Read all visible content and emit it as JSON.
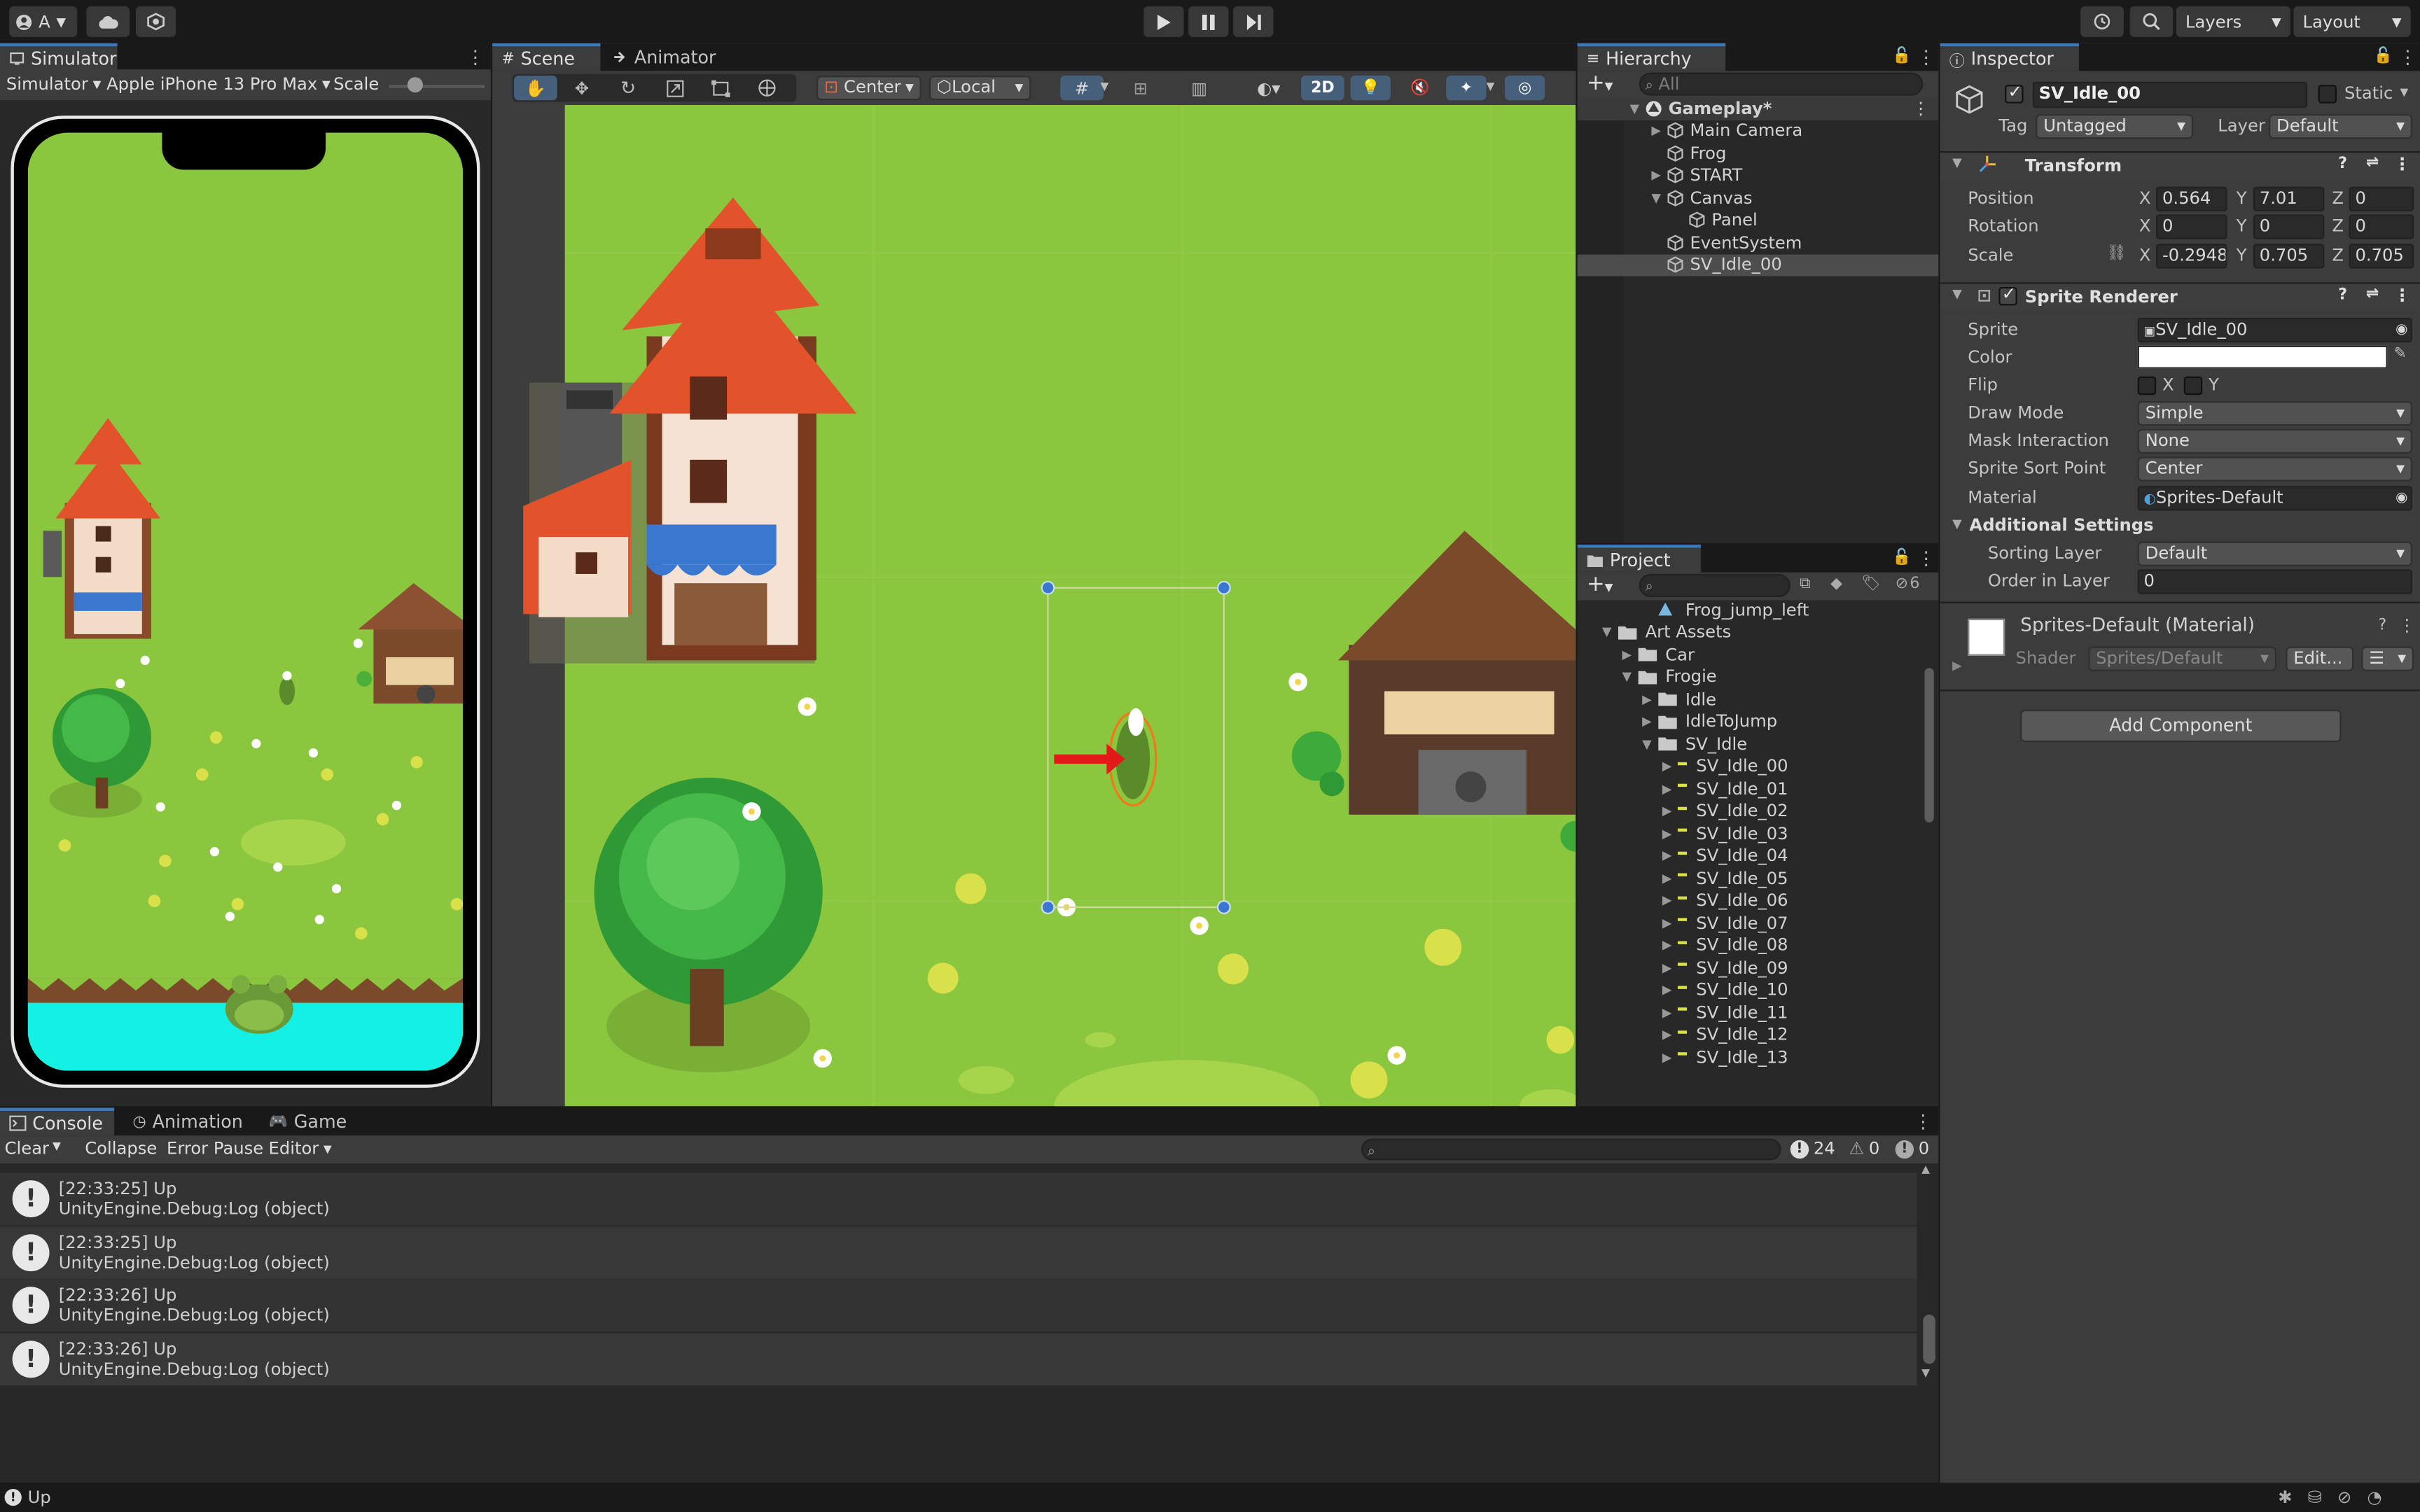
{
  "toolbar": {
    "account": "A",
    "layers": "Layers",
    "layout": "Layout"
  },
  "simulator": {
    "tab": "Simulator",
    "mode": "Simulator",
    "device": "Apple iPhone 13 Pro Max",
    "scale_label": "Scale"
  },
  "scene": {
    "tab_scene": "Scene",
    "tab_animator": "Animator",
    "pivot": "Center",
    "space": "Local",
    "mode_2d": "2D"
  },
  "hierarchy": {
    "tab": "Hierarchy",
    "search_placeholder": "All",
    "items": [
      {
        "label": "Gameplay*",
        "indent": 0,
        "arrow": "▼",
        "scene": true
      },
      {
        "label": "Main Camera",
        "indent": 1,
        "arrow": "▶"
      },
      {
        "label": "Frog",
        "indent": 1,
        "arrow": ""
      },
      {
        "label": "START",
        "indent": 1,
        "arrow": "▶"
      },
      {
        "label": "Canvas",
        "indent": 1,
        "arrow": "▼"
      },
      {
        "label": "Panel",
        "indent": 2,
        "arrow": ""
      },
      {
        "label": "EventSystem",
        "indent": 1,
        "arrow": ""
      },
      {
        "label": "SV_Idle_00",
        "indent": 1,
        "arrow": "",
        "selected": true
      }
    ]
  },
  "project": {
    "tab": "Project",
    "hidden_count": "6",
    "items": [
      {
        "label": "Frog_jump_left",
        "indent": 2,
        "type": "anim",
        "arrow": ""
      },
      {
        "label": "Art Assets",
        "indent": 0,
        "type": "folder",
        "arrow": "▼"
      },
      {
        "label": "Car",
        "indent": 1,
        "type": "folder",
        "arrow": "▶"
      },
      {
        "label": "Frogie",
        "indent": 1,
        "type": "folder",
        "arrow": "▼"
      },
      {
        "label": "Idle",
        "indent": 2,
        "type": "folder",
        "arrow": "▶"
      },
      {
        "label": "IdleToJump",
        "indent": 2,
        "type": "folder",
        "arrow": "▶"
      },
      {
        "label": "SV_Idle",
        "indent": 2,
        "type": "folder",
        "arrow": "▼"
      },
      {
        "label": "SV_Idle_00",
        "indent": 3,
        "type": "sprite",
        "arrow": "▶"
      },
      {
        "label": "SV_Idle_01",
        "indent": 3,
        "type": "sprite",
        "arrow": "▶"
      },
      {
        "label": "SV_Idle_02",
        "indent": 3,
        "type": "sprite",
        "arrow": "▶"
      },
      {
        "label": "SV_Idle_03",
        "indent": 3,
        "type": "sprite",
        "arrow": "▶"
      },
      {
        "label": "SV_Idle_04",
        "indent": 3,
        "type": "sprite",
        "arrow": "▶"
      },
      {
        "label": "SV_Idle_05",
        "indent": 3,
        "type": "sprite",
        "arrow": "▶"
      },
      {
        "label": "SV_Idle_06",
        "indent": 3,
        "type": "sprite",
        "arrow": "▶"
      },
      {
        "label": "SV_Idle_07",
        "indent": 3,
        "type": "sprite",
        "arrow": "▶"
      },
      {
        "label": "SV_Idle_08",
        "indent": 3,
        "type": "sprite",
        "arrow": "▶"
      },
      {
        "label": "SV_Idle_09",
        "indent": 3,
        "type": "sprite",
        "arrow": "▶"
      },
      {
        "label": "SV_Idle_10",
        "indent": 3,
        "type": "sprite",
        "arrow": "▶"
      },
      {
        "label": "SV_Idle_11",
        "indent": 3,
        "type": "sprite",
        "arrow": "▶"
      },
      {
        "label": "SV_Idle_12",
        "indent": 3,
        "type": "sprite",
        "arrow": "▶"
      },
      {
        "label": "SV_Idle_13",
        "indent": 3,
        "type": "sprite",
        "arrow": "▶"
      }
    ]
  },
  "inspector": {
    "tab": "Inspector",
    "object_name": "SV_Idle_00",
    "static_label": "Static",
    "tag_label": "Tag",
    "tag_value": "Untagged",
    "layer_label": "Layer",
    "layer_value": "Default",
    "transform": {
      "title": "Transform",
      "position_label": "Position",
      "rotation_label": "Rotation",
      "scale_label": "Scale",
      "position": {
        "x": "0.564",
        "y": "7.01",
        "z": "0"
      },
      "rotation": {
        "x": "0",
        "y": "0",
        "z": "0"
      },
      "scale": {
        "x": "-0.2948",
        "y": "0.705",
        "z": "0.705"
      }
    },
    "sprite_renderer": {
      "title": "Sprite Renderer",
      "sprite_label": "Sprite",
      "sprite_value": "SV_Idle_00",
      "color_label": "Color",
      "color_value": "#FFFFFF",
      "flip_label": "Flip",
      "flip_x": "X",
      "flip_y": "Y",
      "draw_mode_label": "Draw Mode",
      "draw_mode_value": "Simple",
      "mask_label": "Mask Interaction",
      "mask_value": "None",
      "sort_point_label": "Sprite Sort Point",
      "sort_point_value": "Center",
      "material_label": "Material",
      "material_value": "Sprites-Default",
      "additional_label": "Additional Settings",
      "sorting_layer_label": "Sorting Layer",
      "sorting_layer_value": "Default",
      "order_label": "Order in Layer",
      "order_value": "0"
    },
    "material": {
      "title": "Sprites-Default (Material)",
      "shader_label": "Shader",
      "shader_value": "Sprites/Default",
      "edit_label": "Edit..."
    },
    "add_component": "Add Component"
  },
  "bottom": {
    "tab_console": "Console",
    "tab_animation": "Animation",
    "tab_game": "Game",
    "clear": "Clear",
    "collapse": "Collapse",
    "error_pause": "Error Pause",
    "editor": "Editor",
    "log_count": "24",
    "warn_count": "0",
    "error_count": "0",
    "logs": [
      {
        "line1": "[22:33:25] Up",
        "line2": "UnityEngine.Debug:Log (object)"
      },
      {
        "line1": "[22:33:25] Up",
        "line2": "UnityEngine.Debug:Log (object)"
      },
      {
        "line1": "[22:33:26] Up",
        "line2": "UnityEngine.Debug:Log (object)"
      },
      {
        "line1": "[22:33:26] Up",
        "line2": "UnityEngine.Debug:Log (object)"
      }
    ]
  },
  "status": {
    "text": "Up"
  },
  "colors": {
    "accent": "#3a79bb",
    "grass": "#8bc63f",
    "water": "#15f0e4",
    "selection": "#4d4d4d"
  }
}
